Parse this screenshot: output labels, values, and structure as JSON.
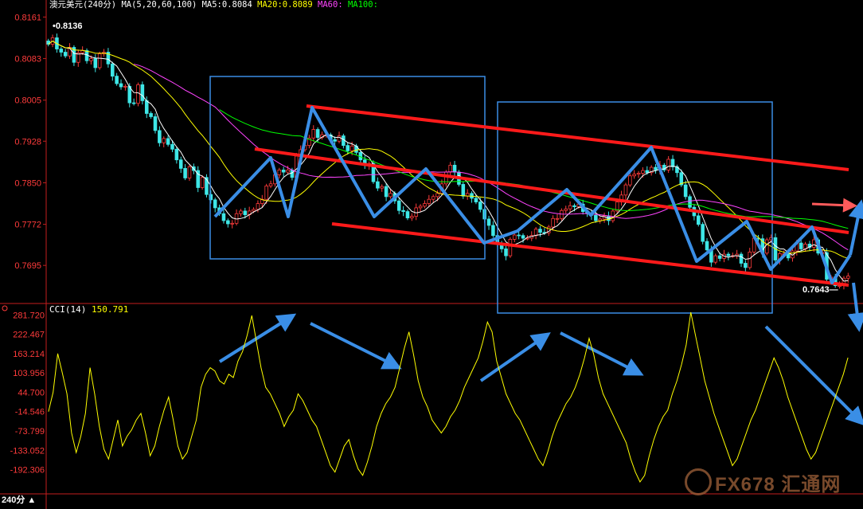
{
  "header": {
    "symbol": "澳元美元(240分)",
    "ma_params": "MA(5,20,60,100)",
    "ma5_label": "MA5:",
    "ma5_value": "0.8084",
    "ma20_label": "MA20:",
    "ma20_value": "0.8089",
    "ma60_label": "MA60:",
    "ma100_label": "MA100:"
  },
  "cci_header": {
    "label": "CCI(14)",
    "value": "150.791"
  },
  "period_label": "240分 ▲",
  "watermark": "FX678 汇通网",
  "colors": {
    "up": "#ff3b3b",
    "down": "#3ee7e7",
    "ma5": "#ffffff",
    "ma20": "#ffff00",
    "ma60": "#ff44ff",
    "ma100": "#00ff00",
    "cci": "#ffff00",
    "annotation_red": "#ff1a1a",
    "annotation_blue": "#3a8ee6"
  },
  "chart_data": [
    {
      "type": "candlestick",
      "title": "澳元美元(240分)",
      "y_ticks": [
        "0.8161",
        "0.8083",
        "0.8005",
        "0.7928",
        "0.7850",
        "0.7772",
        "0.7695"
      ],
      "ylim": [
        0.7625,
        0.8172
      ],
      "annotations": {
        "high": "0.8136",
        "low": "0.7643"
      },
      "close": [
        0.811,
        0.8122,
        0.8101,
        0.8095,
        0.8088,
        0.8104,
        0.8076,
        0.8094,
        0.8098,
        0.8079,
        0.8083,
        0.8066,
        0.8092,
        0.8095,
        0.8073,
        0.805,
        0.8036,
        0.803,
        0.8031,
        0.8,
        0.7999,
        0.8034,
        0.8004,
        0.798,
        0.7974,
        0.7948,
        0.7925,
        0.7933,
        0.7922,
        0.7913,
        0.7893,
        0.7877,
        0.7859,
        0.788,
        0.7873,
        0.7841,
        0.786,
        0.7828,
        0.7818,
        0.7803,
        0.7792,
        0.7779,
        0.7773,
        0.7774,
        0.7792,
        0.7797,
        0.779,
        0.7797,
        0.78,
        0.7811,
        0.7819,
        0.7844,
        0.7848,
        0.7865,
        0.7874,
        0.787,
        0.7874,
        0.786,
        0.79,
        0.7912,
        0.792,
        0.7934,
        0.795,
        0.7935,
        0.794,
        0.794,
        0.7931,
        0.7928,
        0.7938,
        0.792,
        0.791,
        0.7919,
        0.7907,
        0.7893,
        0.7883,
        0.7886,
        0.7852,
        0.784,
        0.7843,
        0.7824,
        0.783,
        0.7816,
        0.7798,
        0.7796,
        0.7784,
        0.7787,
        0.7803,
        0.7806,
        0.7811,
        0.7819,
        0.7824,
        0.783,
        0.7848,
        0.787,
        0.7883,
        0.787,
        0.7847,
        0.7825,
        0.783,
        0.7821,
        0.7814,
        0.78,
        0.7782,
        0.777,
        0.7751,
        0.7735,
        0.7726,
        0.7713,
        0.7744,
        0.7752,
        0.7751,
        0.7746,
        0.7746,
        0.7751,
        0.7763,
        0.7757,
        0.7756,
        0.7767,
        0.7783,
        0.7783,
        0.7798,
        0.7801,
        0.7807,
        0.7805,
        0.781,
        0.7796,
        0.7793,
        0.7789,
        0.7779,
        0.7782,
        0.7788,
        0.7779,
        0.7797,
        0.7814,
        0.7827,
        0.7846,
        0.7863,
        0.7866,
        0.7868,
        0.7873,
        0.7869,
        0.7879,
        0.7874,
        0.7883,
        0.7874,
        0.7894,
        0.788,
        0.7869,
        0.7846,
        0.7824,
        0.7804,
        0.7788,
        0.7772,
        0.774,
        0.7724,
        0.7701,
        0.7713,
        0.7708,
        0.7716,
        0.7713,
        0.7713,
        0.7716,
        0.7699,
        0.7691,
        0.772,
        0.7746,
        0.7745,
        0.7718,
        0.7743,
        0.7747,
        0.7705,
        0.7717,
        0.7717,
        0.7709,
        0.7722,
        0.7737,
        0.7726,
        0.7735,
        0.7729,
        0.7743,
        0.7718,
        0.7719,
        0.7669,
        0.7673,
        0.7657,
        0.7657,
        0.7671,
        0.7675
      ],
      "ma20": [
        0.809,
        0.8093,
        0.8091,
        0.8093,
        0.8097,
        0.8095,
        0.8094,
        0.8095,
        0.8098,
        0.8092,
        0.8089,
        0.8081,
        0.8076,
        0.8074,
        0.8068,
        0.8063,
        0.8058,
        0.8049,
        0.804,
        0.8032,
        0.8021,
        0.801,
        0.8002,
        0.7991,
        0.798,
        0.7968,
        0.7954,
        0.7944,
        0.7934,
        0.7924,
        0.7914,
        0.7906,
        0.7896,
        0.7886,
        0.7876,
        0.7866,
        0.7855,
        0.7845,
        0.7838,
        0.7831,
        0.7825,
        0.782,
        0.7815,
        0.7813,
        0.7813,
        0.7815,
        0.7821,
        0.7825,
        0.7834,
        0.7839,
        0.7847,
        0.7853,
        0.7858,
        0.7864,
        0.7871,
        0.7875,
        0.788,
        0.7881,
        0.7881,
        0.7879,
        0.7875,
        0.787,
        0.7866,
        0.7863,
        0.7859,
        0.7852,
        0.7844,
        0.784,
        0.7835,
        0.7832,
        0.7828,
        0.7825,
        0.7824,
        0.7825,
        0.7826,
        0.7824,
        0.7822,
        0.7818,
        0.7813,
        0.7808,
        0.7801,
        0.7795,
        0.7788,
        0.7785,
        0.7783,
        0.778,
        0.7777,
        0.7774,
        0.7772,
        0.777,
        0.7772,
        0.7776,
        0.7779,
        0.7784,
        0.7788,
        0.7792,
        0.7795,
        0.78,
        0.7803,
        0.7806,
        0.7807,
        0.7802,
        0.7799,
        0.7795,
        0.7789,
        0.7784,
        0.7779,
        0.7774,
        0.7766,
        0.776,
        0.7752,
        0.7743,
        0.7735,
        0.7727,
        0.772,
        0.7714,
        0.771,
        0.7708,
        0.7705,
        0.7704,
        0.7704,
        0.7706,
        0.7711,
        0.7714,
        0.7712,
        0.7708,
        0.7709,
        0.7711,
        0.7714,
        0.7715,
        0.7715,
        0.7717,
        0.7714,
        0.7711,
        0.7712,
        0.7713,
        0.771,
        0.7707,
        0.7704,
        0.7698,
        0.7691,
        0.7687,
        0.7684
      ],
      "cci_ylim": [
        -230,
        290
      ],
      "cci_ticks": [
        "281.720",
        "222.467",
        "163.214",
        "103.956",
        "44.700",
        "-14.546",
        "-73.799",
        "-133.052",
        "-192.306"
      ],
      "cci": [
        -14.5,
        44.7,
        163.2,
        103.9,
        40,
        -80,
        -140,
        -90,
        -20,
        120,
        40,
        -60,
        -130,
        -160,
        -100,
        -40,
        -120,
        -90,
        -70,
        -40,
        -20,
        -80,
        -150,
        -120,
        -60,
        -10,
        30,
        -40,
        -120,
        -160,
        -140,
        -90,
        -40,
        60,
        100,
        120,
        110,
        80,
        70,
        100,
        90,
        140,
        170,
        220,
        280,
        200,
        120,
        60,
        40,
        10,
        -20,
        -60,
        -30,
        -10,
        40,
        20,
        -10,
        -40,
        -60,
        -100,
        -140,
        -180,
        -200,
        -160,
        -120,
        -100,
        -150,
        -190,
        -210,
        -170,
        -120,
        -60,
        -20,
        10,
        30,
        60,
        120,
        180,
        230,
        160,
        80,
        30,
        0,
        -40,
        -60,
        -80,
        -60,
        -30,
        -10,
        20,
        60,
        90,
        120,
        150,
        200,
        260,
        230,
        140,
        90,
        40,
        10,
        -20,
        -40,
        -70,
        -100,
        -130,
        -160,
        -180,
        -140,
        -90,
        -50,
        -20,
        10,
        30,
        60,
        100,
        150,
        210,
        160,
        90,
        40,
        10,
        -20,
        -50,
        -80,
        -110,
        -160,
        -200,
        -230,
        -210,
        -150,
        -100,
        -60,
        -30,
        -10,
        40,
        80,
        130,
        190,
        290,
        220,
        150,
        80,
        30,
        -20,
        -60,
        -100,
        -140,
        -180,
        -160,
        -120,
        -80,
        -40,
        -10,
        30,
        70,
        110,
        150,
        120,
        80,
        30,
        -10,
        -50,
        -90,
        -130,
        -160,
        -140,
        -100,
        -60,
        -20,
        20,
        60,
        100,
        150.8
      ]
    }
  ]
}
